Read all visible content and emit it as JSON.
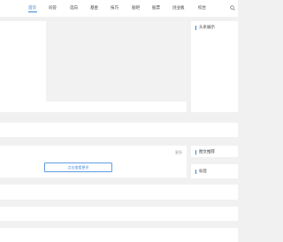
{
  "nav": {
    "items": [
      {
        "label": "首页",
        "active": true
      },
      {
        "label": "问答",
        "active": false
      },
      {
        "label": "选向",
        "active": false
      },
      {
        "label": "基金",
        "active": false
      },
      {
        "label": "技巧",
        "active": false
      },
      {
        "label": "股吧",
        "active": false
      },
      {
        "label": "股票",
        "active": false
      },
      {
        "label": "创业板",
        "active": false
      },
      {
        "label": "综合",
        "active": false
      }
    ],
    "search_icon": "search-icon",
    "accent_color": "#1a73c8"
  },
  "sidebar": {
    "headline_title": "头条展示",
    "recommend_title": "图文推荐",
    "tags_title": "标签"
  },
  "main": {
    "more_label": "更多",
    "load_more_button": "点击查看更多"
  }
}
